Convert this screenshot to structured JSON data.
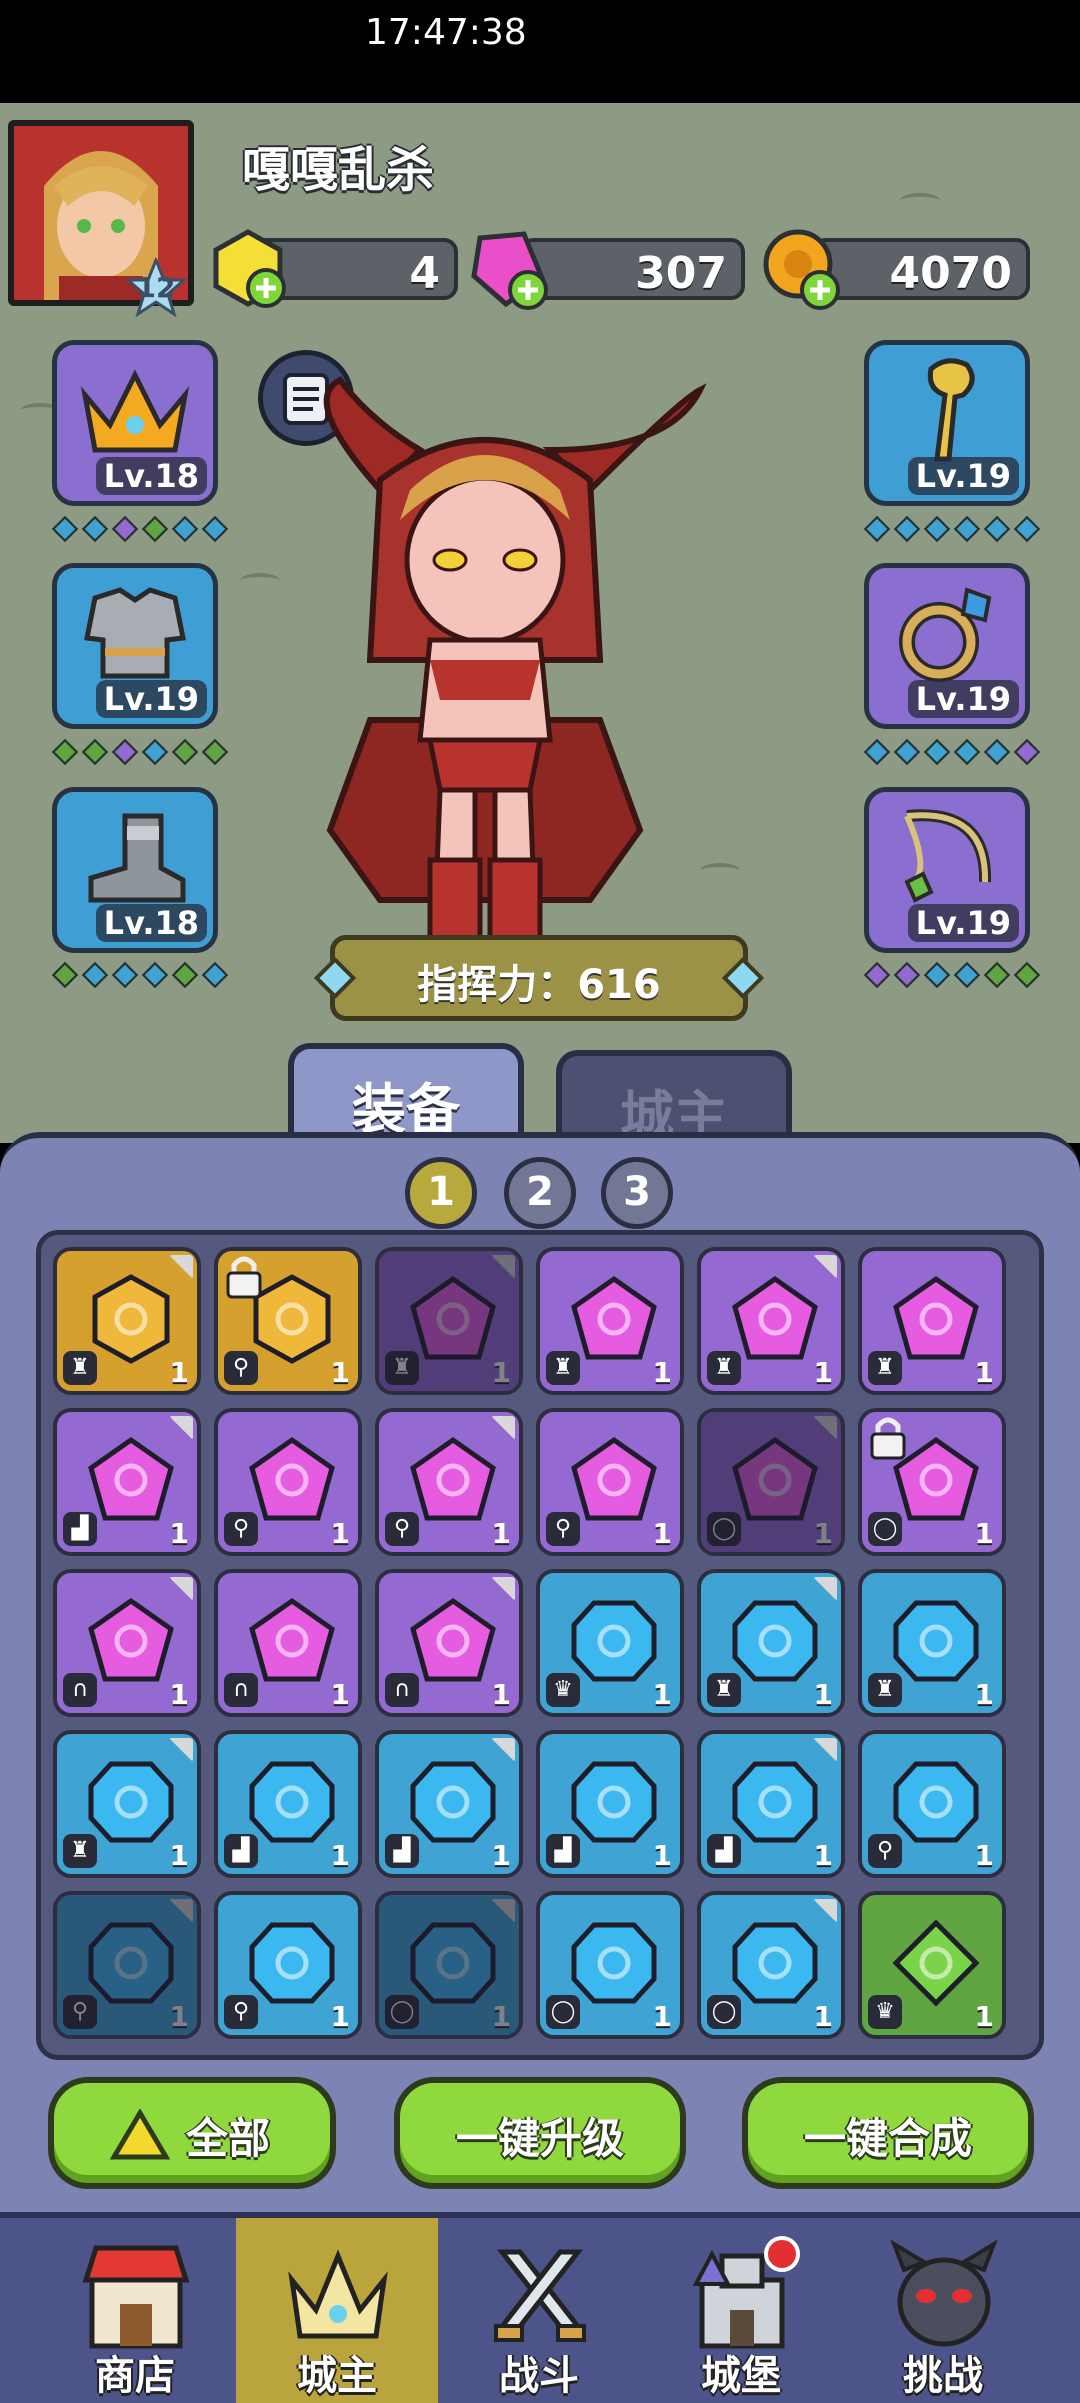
{
  "status_bar": {
    "time": "17:47:38"
  },
  "player": {
    "name": "嘎嘎乱杀",
    "level": "12"
  },
  "currencies": {
    "gold_gems": "4",
    "pink_gems": "307",
    "coins": "4070"
  },
  "equipment": {
    "left": [
      {
        "slot": "crown",
        "level": "Lv.18"
      },
      {
        "slot": "armor",
        "level": "Lv.19"
      },
      {
        "slot": "boots",
        "level": "Lv.18"
      }
    ],
    "right": [
      {
        "slot": "staff",
        "level": "Lv.19"
      },
      {
        "slot": "ring",
        "level": "Lv.19"
      },
      {
        "slot": "necklace",
        "level": "Lv.19"
      }
    ]
  },
  "power": {
    "label": "指挥力：616"
  },
  "tabs": {
    "equipment": "装备",
    "lord": "城主"
  },
  "pages": [
    "1",
    "2",
    "3"
  ],
  "inventory": [
    [
      {
        "c": "gold",
        "t": "armor",
        "n": "1"
      },
      {
        "c": "gold",
        "t": "staff",
        "n": "1",
        "lock": true
      },
      {
        "c": "purple",
        "t": "armor",
        "n": "1",
        "dim": true
      },
      {
        "c": "purple",
        "t": "armor",
        "n": "1"
      },
      {
        "c": "purple",
        "t": "armor",
        "n": "1"
      },
      {
        "c": "purple",
        "t": "armor",
        "n": "1"
      }
    ],
    [
      {
        "c": "purple",
        "t": "boots",
        "n": "1"
      },
      {
        "c": "purple",
        "t": "staff",
        "n": "1"
      },
      {
        "c": "purple",
        "t": "staff",
        "n": "1"
      },
      {
        "c": "purple",
        "t": "staff",
        "n": "1"
      },
      {
        "c": "purple",
        "t": "ring",
        "n": "1",
        "dim": true
      },
      {
        "c": "purple",
        "t": "ring",
        "n": "1",
        "lock": true
      }
    ],
    [
      {
        "c": "purple",
        "t": "necklace",
        "n": "1"
      },
      {
        "c": "purple",
        "t": "necklace",
        "n": "1"
      },
      {
        "c": "purple",
        "t": "necklace",
        "n": "1"
      },
      {
        "c": "blue",
        "t": "crown",
        "n": "1"
      },
      {
        "c": "blue",
        "t": "armor",
        "n": "1"
      },
      {
        "c": "blue",
        "t": "armor",
        "n": "1"
      }
    ],
    [
      {
        "c": "blue",
        "t": "armor",
        "n": "1"
      },
      {
        "c": "blue",
        "t": "boots",
        "n": "1"
      },
      {
        "c": "blue",
        "t": "boots",
        "n": "1"
      },
      {
        "c": "blue",
        "t": "boots",
        "n": "1"
      },
      {
        "c": "blue",
        "t": "boots",
        "n": "1"
      },
      {
        "c": "blue",
        "t": "staff",
        "n": "1"
      }
    ],
    [
      {
        "c": "blue",
        "t": "staff",
        "n": "1",
        "dim": true
      },
      {
        "c": "blue",
        "t": "staff",
        "n": "1"
      },
      {
        "c": "blue",
        "t": "ring",
        "n": "1",
        "dim": true
      },
      {
        "c": "blue",
        "t": "ring",
        "n": "1"
      },
      {
        "c": "blue",
        "t": "ring",
        "n": "1"
      },
      {
        "c": "green",
        "t": "crown",
        "n": "1"
      }
    ]
  ],
  "actions": {
    "all": "全部",
    "upgrade_all": "一键升级",
    "merge_all": "一键合成"
  },
  "nav": {
    "shop": "商店",
    "lord": "城主",
    "battle": "战斗",
    "castle": "城堡",
    "challenge": "挑战"
  }
}
